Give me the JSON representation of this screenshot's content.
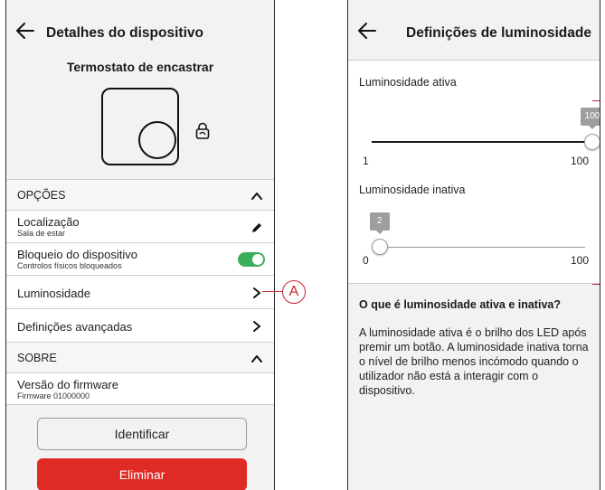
{
  "left": {
    "header": {
      "title": "Detalhes do dispositivo",
      "back_icon": "arrow-left-icon"
    },
    "device_name": "Termostato de encastrar",
    "sections": {
      "options_label": "OPÇÕES",
      "about_label": "SOBRE"
    },
    "rows": {
      "location": {
        "label": "Localização",
        "value": "Sala de estar",
        "icon": "pencil-icon"
      },
      "lock": {
        "label": "Bloqueio do dispositivo",
        "value": "Controlos físicos bloqueados",
        "toggle_on": true,
        "toggle_color": "#3dae5b"
      },
      "brightness": {
        "label": "Luminosidade",
        "icon": "chevron-right-icon"
      },
      "advanced": {
        "label": "Definições avançadas",
        "icon": "chevron-right-icon"
      },
      "firmware": {
        "label": "Versão do firmware",
        "value": "Firmware 01000000"
      }
    },
    "callout": "A",
    "buttons": {
      "identify": "Identificar",
      "delete": "Eliminar",
      "delete_color": "#e02a26"
    }
  },
  "right": {
    "header": {
      "title": "Definições de luminosidade",
      "back_icon": "arrow-left-icon"
    },
    "active": {
      "label": "Luminosidade ativa",
      "value": "100",
      "min_label": "1",
      "max_label": "100",
      "level": 1.0
    },
    "inactive": {
      "label": "Luminosidade inativa",
      "value": "2",
      "min_label": "0",
      "max_label": "100",
      "level": 0.02
    },
    "info": {
      "title": "O que é luminosidade ativa e inativa?",
      "text": "A luminosidade ativa é o brilho dos LED após premir um botão. A luminosidade inativa torna o nível de brilho menos incómodo quando o utilizador não está a interagir com o dispositivo."
    }
  }
}
